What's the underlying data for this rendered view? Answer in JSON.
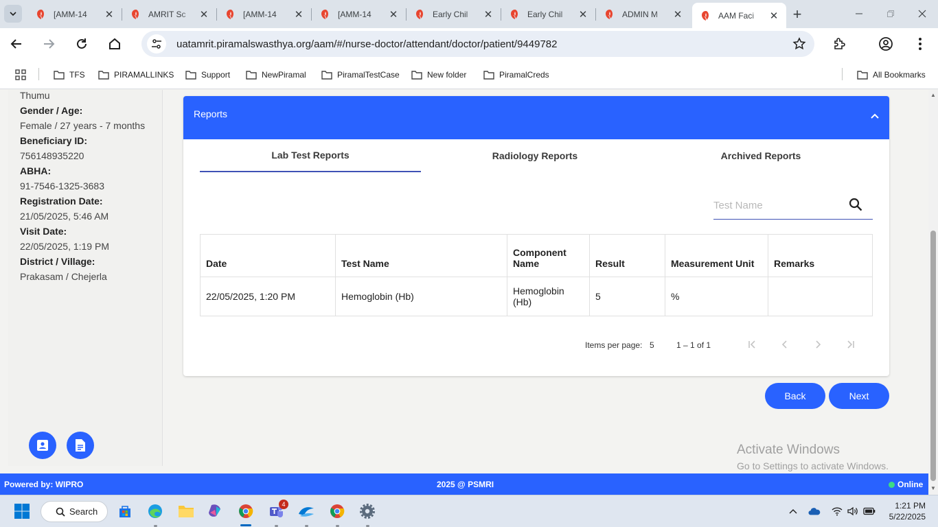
{
  "browser": {
    "tabs": [
      {
        "title": "[AMM-14",
        "favicon": "amrit-logo-icon"
      },
      {
        "title": "AMRIT Sc",
        "favicon": "amrit-logo-icon"
      },
      {
        "title": "[AMM-14",
        "favicon": "amrit-logo-icon"
      },
      {
        "title": "[AMM-14",
        "favicon": "amrit-logo-icon"
      },
      {
        "title": "Early Chil",
        "favicon": "amrit-logo-icon"
      },
      {
        "title": "Early Chil",
        "favicon": "amrit-logo-icon"
      },
      {
        "title": "ADMIN M",
        "favicon": "amrit-logo-icon"
      },
      {
        "title": "AAM Faci",
        "favicon": "amrit-logo-icon",
        "active": true
      }
    ],
    "tab_close": "✕",
    "new_tab": "+",
    "url": "uatamrit.piramalswasthya.org/aam/#/nurse-doctor/attendant/doctor/patient/9449782",
    "bookmarks": [
      "TFS",
      "PIRAMALLINKS",
      "Support",
      "NewPiramal",
      "PiramalTestCase",
      "New folder",
      "PiramalCreds"
    ],
    "all_bookmarks": "All Bookmarks"
  },
  "patient": {
    "name_tail": "Thumu",
    "gender_age_label": "Gender / Age:",
    "gender_age": "Female / 27 years - 7 months",
    "beneficiary_id_label": "Beneficiary ID:",
    "beneficiary_id": "756148935220",
    "abha_label": "ABHA:",
    "abha": "91-7546-1325-3683",
    "registration_date_label": "Registration Date:",
    "registration_date": "21/05/2025, 5:46 AM",
    "visit_date_label": "Visit Date:",
    "visit_date": "22/05/2025, 1:19 PM",
    "district_label": "District / Village:",
    "district": "Prakasam / Chejerla"
  },
  "reports": {
    "title": "Reports",
    "tabs": [
      "Lab Test Reports",
      "Radiology Reports",
      "Archived Reports"
    ],
    "active_tab": 0,
    "search_placeholder": "Test Name",
    "columns": [
      "Date",
      "Test Name",
      "Component Name",
      "Result",
      "Measurement Unit",
      "Remarks"
    ],
    "rows": [
      [
        "22/05/2025, 1:20 PM",
        "Hemoglobin (Hb)",
        "Hemoglobin (Hb)",
        "5",
        "%",
        ""
      ]
    ],
    "items_per_page_label": "Items per page:",
    "items_per_page": "5",
    "range": "1 – 1 of 1"
  },
  "actions": {
    "back": "Back",
    "next": "Next"
  },
  "watermark": {
    "line1": "Activate Windows",
    "line2": "Go to Settings to activate Windows."
  },
  "footer": {
    "left": "Powered by: WIPRO",
    "center": "2025 @ PSMRI",
    "right": "Online"
  },
  "taskbar": {
    "search": "Search",
    "teams_badge": "4",
    "time": "1:21 PM",
    "date": "5/22/2025"
  },
  "colors": {
    "brand_blue": "#2962ff",
    "tab_indicator": "#3f51b5",
    "online": "#3ddc84"
  }
}
